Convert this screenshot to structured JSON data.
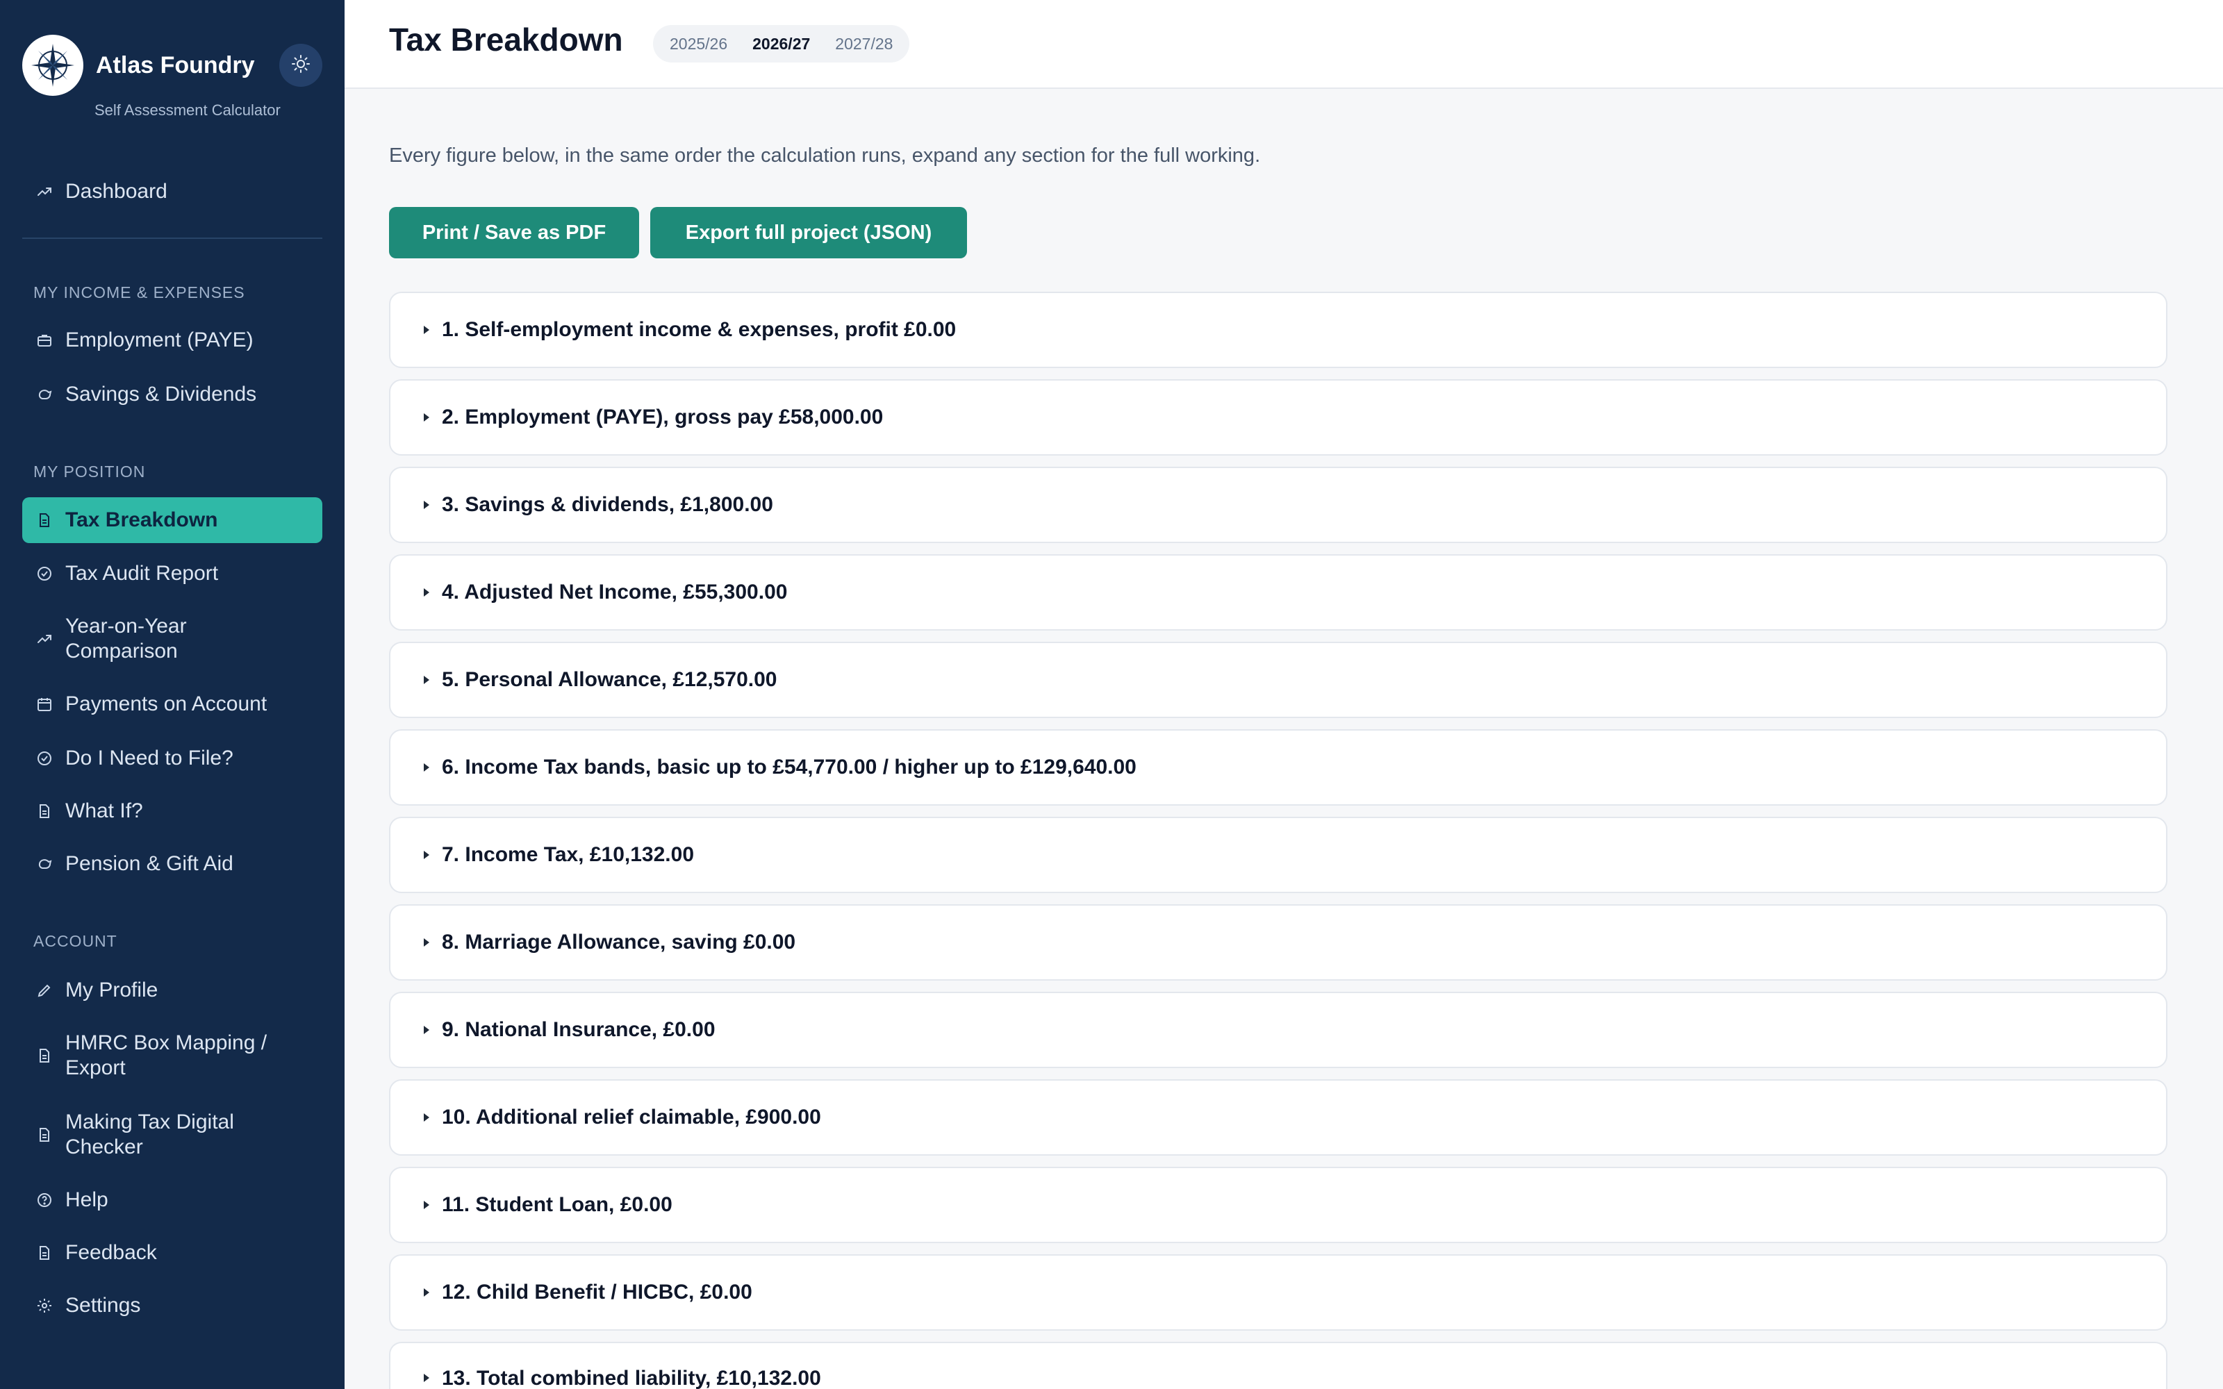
{
  "brand": {
    "name": "Atlas Foundry",
    "subtitle": "Self Assessment Calculator"
  },
  "sidebar": {
    "dashboard": "Dashboard",
    "sections": [
      {
        "label": "MY INCOME & EXPENSES"
      },
      {
        "label": "MY POSITION"
      },
      {
        "label": "ACCOUNT"
      }
    ],
    "items": [
      {
        "label": "Employment (PAYE)",
        "icon": "briefcase-icon"
      },
      {
        "label": "Savings & Dividends",
        "icon": "piggy-bank-icon"
      },
      {
        "label": "Tax Breakdown",
        "icon": "document-icon",
        "active": true
      },
      {
        "label": "Tax Audit Report",
        "icon": "check-circle-icon"
      },
      {
        "label": "Year-on-Year\nComparison",
        "icon": "trend-icon"
      },
      {
        "label": "Payments on Account",
        "icon": "calendar-icon"
      },
      {
        "label": "Do I Need to File?",
        "icon": "check-circle-icon"
      },
      {
        "label": "What If?",
        "icon": "document-icon"
      },
      {
        "label": "Pension & Gift Aid",
        "icon": "piggy-bank-icon"
      },
      {
        "label": "My Profile",
        "icon": "pencil-icon"
      },
      {
        "label": "HMRC Box Mapping /\nExport",
        "icon": "document-icon"
      },
      {
        "label": "Making Tax Digital\nChecker",
        "icon": "document-icon"
      },
      {
        "label": "Help",
        "icon": "help-circle-icon"
      },
      {
        "label": "Feedback",
        "icon": "document-icon"
      },
      {
        "label": "Settings",
        "icon": "gear-icon"
      }
    ]
  },
  "header": {
    "title": "Tax Breakdown",
    "years": [
      "2025/26",
      "2026/27",
      "2027/28"
    ],
    "selected_year": "2026/27"
  },
  "main": {
    "intro": "Every figure below, in the same order the calculation runs, expand any section for the full working.",
    "print_button": "Print / Save as PDF",
    "export_button": "Export full project (JSON)",
    "sections": [
      "1. Self-employment income & expenses, profit £0.00",
      "2. Employment (PAYE), gross pay £58,000.00",
      "3. Savings & dividends, £1,800.00",
      "4. Adjusted Net Income, £55,300.00",
      "5. Personal Allowance, £12,570.00",
      "6. Income Tax bands, basic up to £54,770.00 / higher up to £129,640.00",
      "7. Income Tax, £10,132.00",
      "8. Marriage Allowance, saving £0.00",
      "9. National Insurance, £0.00",
      "10. Additional relief claimable, £900.00",
      "11. Student Loan, £0.00",
      "12. Child Benefit / HICBC, £0.00",
      "13. Total combined liability, £10,132.00"
    ]
  },
  "colors": {
    "sidebar_bg": "#132a4a",
    "active_item": "#2fb9a7",
    "button": "#1e8b79"
  }
}
